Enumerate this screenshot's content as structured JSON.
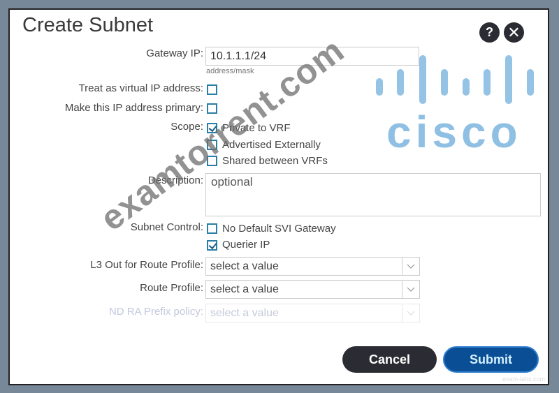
{
  "dialog": {
    "title": "Create Subnet",
    "help_icon": "?",
    "close_icon": "✕"
  },
  "form": {
    "gateway_ip": {
      "label": "Gateway IP:",
      "value": "10.1.1.1/24",
      "hint": "address/mask"
    },
    "virtual_ip": {
      "label": "Treat as virtual IP address:",
      "checked": false
    },
    "primary_ip": {
      "label": "Make this IP address primary:",
      "checked": false
    },
    "scope": {
      "label": "Scope:",
      "options": [
        {
          "label": "Private to VRF",
          "checked": true
        },
        {
          "label": "Advertised Externally",
          "checked": false
        },
        {
          "label": "Shared between VRFs",
          "checked": false
        }
      ]
    },
    "description": {
      "label": "Description:",
      "placeholder": "optional"
    },
    "subnet_control": {
      "label": "Subnet Control:",
      "options": [
        {
          "label": "No Default SVI Gateway",
          "checked": false
        },
        {
          "label": "Querier IP",
          "checked": true
        }
      ]
    },
    "l3out_route_profile": {
      "label": "L3 Out for Route Profile:",
      "value": "select a value"
    },
    "route_profile": {
      "label": "Route Profile:",
      "value": "select a value"
    },
    "nd_ra_prefix_policy": {
      "label": "ND RA Prefix policy:",
      "value": "select a value",
      "disabled": true
    }
  },
  "buttons": {
    "cancel": "Cancel",
    "submit": "Submit"
  },
  "watermark": {
    "text": "examtorrent.com",
    "logo": "cisco",
    "credit": "exam-labs.com"
  },
  "colors": {
    "submit": "#0a4f95",
    "cancel": "#2b2b33",
    "checkbox": "#2a7fa8",
    "logo": "#8fc0e4"
  }
}
